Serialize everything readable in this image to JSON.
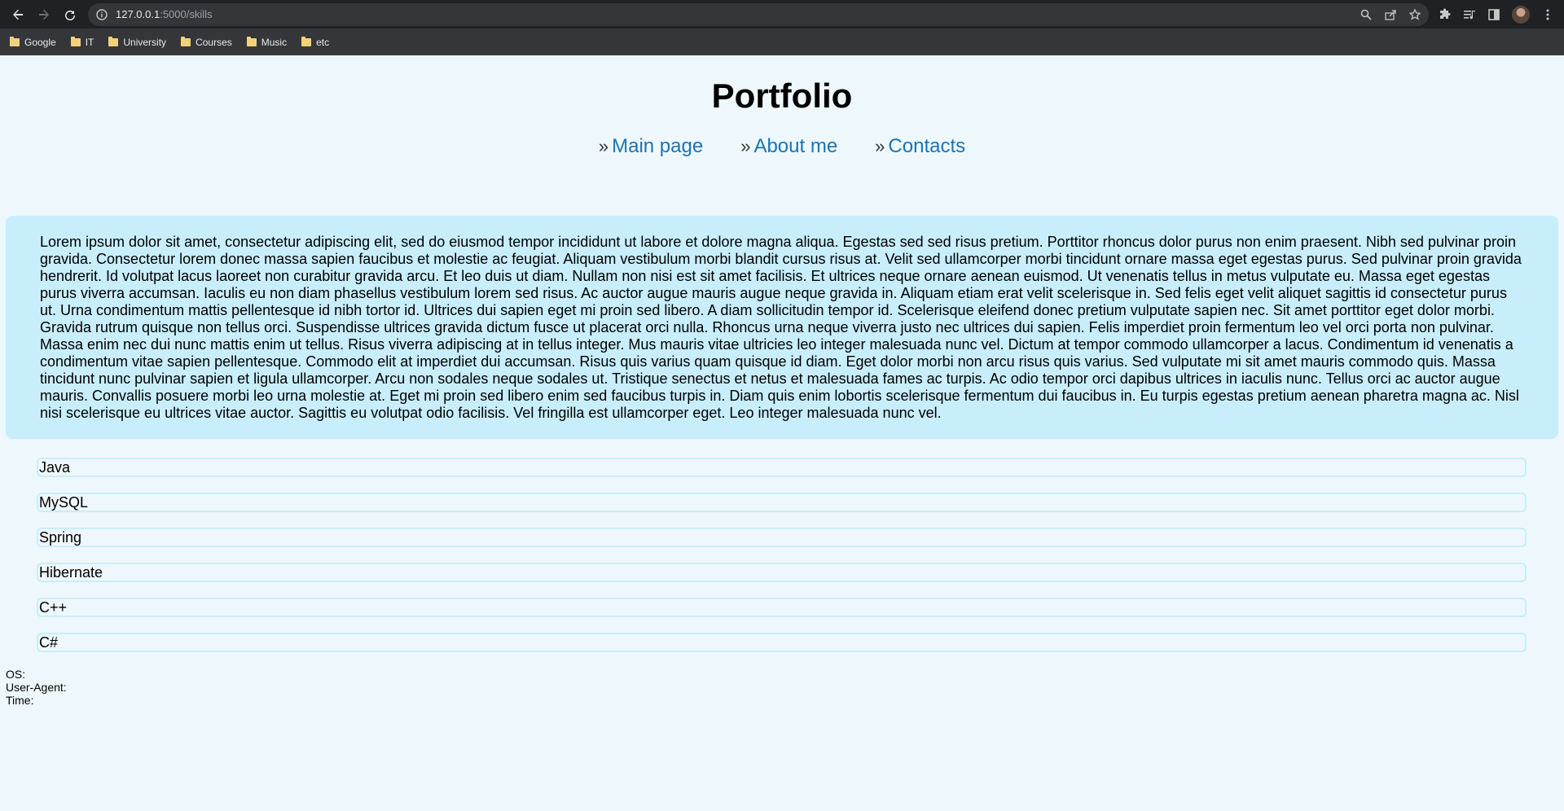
{
  "browser": {
    "url_host": "127.0.0.1",
    "url_path": ":5000/skills",
    "bookmarks": [
      "Google",
      "IT",
      "University",
      "Courses",
      "Music",
      "etc"
    ]
  },
  "page": {
    "title": "Portfolio",
    "nav": [
      "Main page",
      "About me",
      "Contacts"
    ],
    "intro": "Lorem ipsum dolor sit amet, consectetur adipiscing elit, sed do eiusmod tempor incididunt ut labore et dolore magna aliqua. Egestas sed sed risus pretium. Porttitor rhoncus dolor purus non enim praesent. Nibh sed pulvinar proin gravida. Consectetur lorem donec massa sapien faucibus et molestie ac feugiat. Aliquam vestibulum morbi blandit cursus risus at. Velit sed ullamcorper morbi tincidunt ornare massa eget egestas purus. Sed pulvinar proin gravida hendrerit. Id volutpat lacus laoreet non curabitur gravida arcu. Et leo duis ut diam. Nullam non nisi est sit amet facilisis. Et ultrices neque ornare aenean euismod. Ut venenatis tellus in metus vulputate eu. Massa eget egestas purus viverra accumsan. Iaculis eu non diam phasellus vestibulum lorem sed risus. Ac auctor augue mauris augue neque gravida in. Aliquam etiam erat velit scelerisque in. Sed felis eget velit aliquet sagittis id consectetur purus ut. Urna condimentum mattis pellentesque id nibh tortor id. Ultrices dui sapien eget mi proin sed libero. A diam sollicitudin tempor id. Scelerisque eleifend donec pretium vulputate sapien nec. Sit amet porttitor eget dolor morbi. Gravida rutrum quisque non tellus orci. Suspendisse ultrices gravida dictum fusce ut placerat orci nulla. Rhoncus urna neque viverra justo nec ultrices dui sapien. Felis imperdiet proin fermentum leo vel orci porta non pulvinar. Massa enim nec dui nunc mattis enim ut tellus. Risus viverra adipiscing at in tellus integer. Mus mauris vitae ultricies leo integer malesuada nunc vel. Dictum at tempor commodo ullamcorper a lacus. Condimentum id venenatis a condimentum vitae sapien pellentesque. Commodo elit at imperdiet dui accumsan. Risus quis varius quam quisque id diam. Eget dolor morbi non arcu risus quis varius. Sed vulputate mi sit amet mauris commodo quis. Massa tincidunt nunc pulvinar sapien et ligula ullamcorper. Arcu non sodales neque sodales ut. Tristique senectus et netus et malesuada fames ac turpis. Ac odio tempor orci dapibus ultrices in iaculis nunc. Tellus orci ac auctor augue mauris. Convallis posuere morbi leo urna molestie at. Eget mi proin sed libero enim sed faucibus turpis in. Diam quis enim lobortis scelerisque fermentum dui faucibus in. Eu turpis egestas pretium aenean pharetra magna ac. Nisl nisi scelerisque eu ultrices vitae auctor. Sagittis eu volutpat odio facilisis. Vel fringilla est ullamcorper eget. Leo integer malesuada nunc vel.",
    "skills": [
      "Java",
      "MySQL",
      "Spring",
      "Hibernate",
      "C++",
      "C#"
    ],
    "info": {
      "os": "OS:",
      "user_agent": "User-Agent:",
      "time": "Time:"
    }
  },
  "colors": {
    "page_bg": "#eef8fc",
    "panel_bg": "#c8eefc",
    "link": "#1a73b5"
  }
}
